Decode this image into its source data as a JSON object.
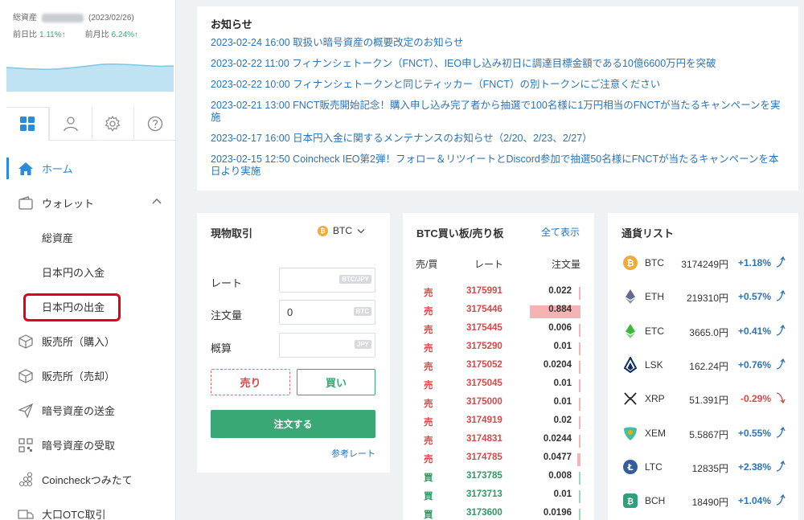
{
  "assets": {
    "label": "総資産",
    "date": "(2023/02/26)",
    "day_label": "前日比",
    "day_value": "1.11%↑",
    "month_label": "前月比",
    "month_value": "6.24%↑"
  },
  "nav": {
    "items": [
      {
        "label": "ホーム"
      },
      {
        "label": "ウォレット"
      },
      {
        "label": "総資産"
      },
      {
        "label": "日本円の入金"
      },
      {
        "label": "日本円の出金"
      },
      {
        "label": "販売所（購入）"
      },
      {
        "label": "販売所（売却）"
      },
      {
        "label": "暗号資産の送金"
      },
      {
        "label": "暗号資産の受取"
      },
      {
        "label": "Coincheckつみたて"
      },
      {
        "label": "大口OTC取引"
      }
    ]
  },
  "news": {
    "title": "お知らせ",
    "items": [
      "2023-02-24 16:00 取扱い暗号資産の概要改定のお知らせ",
      "2023-02-22 11:00 フィナンシェトークン（FNCT）、IEO申し込み初日に調達目標金額である10億6600万円を突破",
      "2023-02-22 10:00 フィナンシェトークンと同じティッカー（FNCT）の別トークンにご注意ください",
      "2023-02-21 13:00 FNCT販売開始記念！購入申し込み完了者から抽選で100名様に1万円相当のFNCTが当たるキャンペーンを実施",
      "2023-02-17 16:00 日本円入金に関するメンテナンスのお知らせ（2/20、2/23、2/27）",
      "2023-02-15 12:50 Coincheck IEO第2弾！フォロー＆リツイートとDiscord参加で抽選50名様にFNCTが当たるキャンペーンを本日より実施"
    ]
  },
  "trade": {
    "title": "現物取引",
    "coin": "BTC",
    "rate_label": "レート",
    "rate_tag": "BTC/JPY",
    "amount_label": "注文量",
    "amount_value": "0",
    "amount_tag": "BTC",
    "estimate_label": "概算",
    "estimate_tag": "JPY",
    "sell": "売り",
    "buy": "買い",
    "order": "注文する",
    "ref": "参考レート"
  },
  "book": {
    "title": "BTC買い板/売り板",
    "show_all": "全て表示",
    "h_side": "売/買",
    "h_rate": "レート",
    "h_qty": "注文量",
    "rows": [
      {
        "side": "売",
        "rate": "3175991",
        "qty": "0.022",
        "depth": 0.02
      },
      {
        "side": "売",
        "rate": "3175446",
        "qty": "0.884",
        "depth": 0.9
      },
      {
        "side": "売",
        "rate": "3175445",
        "qty": "0.006",
        "depth": 0
      },
      {
        "side": "売",
        "rate": "3175290",
        "qty": "0.01",
        "depth": 0
      },
      {
        "side": "売",
        "rate": "3175052",
        "qty": "0.0204",
        "depth": 0
      },
      {
        "side": "売",
        "rate": "3175045",
        "qty": "0.01",
        "depth": 0
      },
      {
        "side": "売",
        "rate": "3175000",
        "qty": "0.01",
        "depth": 0
      },
      {
        "side": "売",
        "rate": "3174919",
        "qty": "0.02",
        "depth": 0
      },
      {
        "side": "売",
        "rate": "3174831",
        "qty": "0.0244",
        "depth": 0
      },
      {
        "side": "売",
        "rate": "3174785",
        "qty": "0.0477",
        "depth": 0.05
      },
      {
        "side": "買",
        "rate": "3173785",
        "qty": "0.008",
        "depth": 0
      },
      {
        "side": "買",
        "rate": "3173713",
        "qty": "0.01",
        "depth": 0
      },
      {
        "side": "買",
        "rate": "3173600",
        "qty": "0.0196",
        "depth": 0
      }
    ]
  },
  "coins": {
    "title": "通貨リスト",
    "rows": [
      {
        "sym": "BTC",
        "price": "3174249円",
        "chg": "+1.18%",
        "icon": "btc-icon",
        "color": "#f2a93b",
        "up": true
      },
      {
        "sym": "ETH",
        "price": "219310円",
        "chg": "+0.57%",
        "icon": "eth-icon",
        "color": "#62688f",
        "up": true
      },
      {
        "sym": "ETC",
        "price": "3665.0円",
        "chg": "+0.41%",
        "icon": "etc-icon",
        "color": "#3ab83a",
        "up": true
      },
      {
        "sym": "LSK",
        "price": "162.24円",
        "chg": "+0.76%",
        "icon": "lsk-icon",
        "color": "#0d2d5e",
        "up": true
      },
      {
        "sym": "XRP",
        "price": "51.391円",
        "chg": "-0.29%",
        "icon": "xrp-icon",
        "color": "#23292f",
        "up": false
      },
      {
        "sym": "XEM",
        "price": "5.5867円",
        "chg": "+0.55%",
        "icon": "xem-icon",
        "color": "#41bea8",
        "up": true
      },
      {
        "sym": "LTC",
        "price": "12835円",
        "chg": "+2.38%",
        "icon": "ltc-icon",
        "color": "#345d9d",
        "up": true
      },
      {
        "sym": "BCH",
        "price": "18490円",
        "chg": "+1.04%",
        "icon": "bch-icon",
        "color": "#2ea07b",
        "up": true
      }
    ]
  }
}
